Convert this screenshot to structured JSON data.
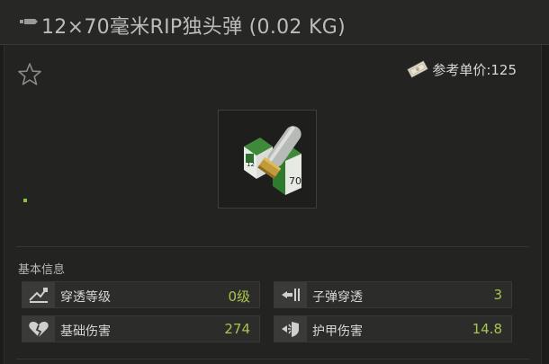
{
  "title": {
    "text": "12×70毫米RIP独头弹 (0.02 KG)",
    "icon": "ammo-icon"
  },
  "favorite": {
    "icon": "star-icon"
  },
  "price": {
    "label": "参考单价:125",
    "icon": "roubles-money-icon"
  },
  "item": {
    "icon": "shotgun-shell-ammo-box-icon"
  },
  "stats_section": {
    "title": "基本信息",
    "stats": [
      {
        "label": "穿透等级",
        "value": "0级",
        "icon": "penetration-level-icon"
      },
      {
        "label": "子弹穿透",
        "value": "3",
        "icon": "bullet-penetration-icon"
      },
      {
        "label": "基础伤害",
        "value": "274",
        "icon": "broken-heart-damage-icon"
      },
      {
        "label": "护甲伤害",
        "value": "14.8",
        "icon": "armor-damage-icon"
      }
    ]
  },
  "colors": {
    "accent_value": "#a7c44f",
    "rarity_dot": "#8fbf3c",
    "background": "#1c1c1b"
  }
}
